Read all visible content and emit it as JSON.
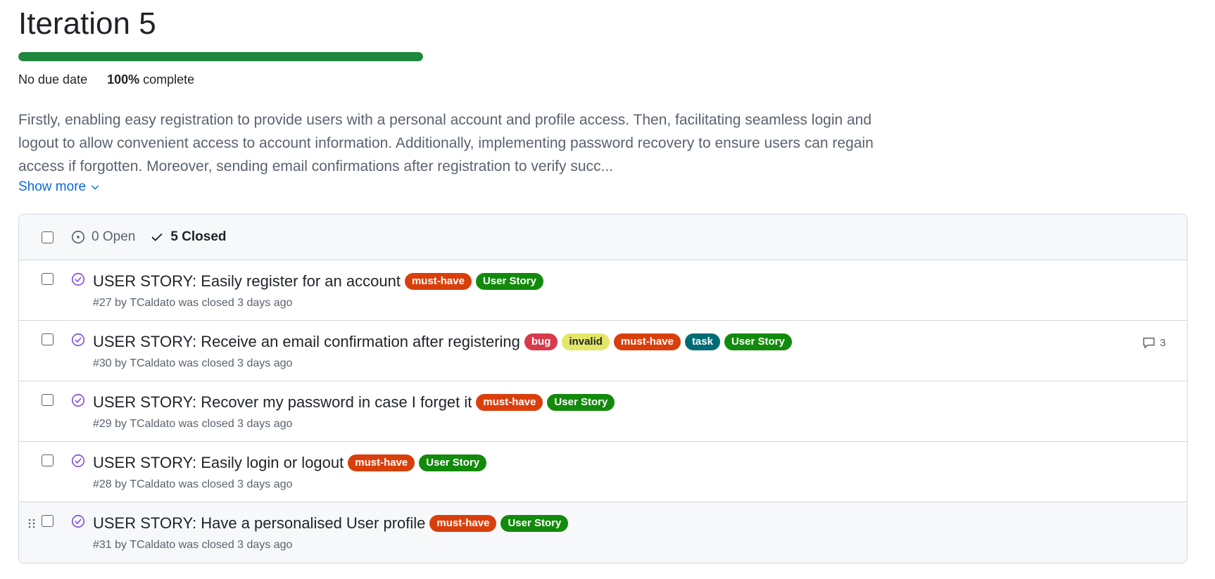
{
  "milestone": {
    "title": "Iteration 5",
    "progress": 1.0,
    "due": "No due date",
    "percent": "100%",
    "complete_label": "complete",
    "description": "Firstly, enabling easy registration to provide users with a personal account and profile access. Then, facilitating seamless login and logout to allow convenient access to account information. Additionally, implementing password recovery to ensure users can regain access if forgotten. Moreover, sending email confirmations after registration to verify succ...",
    "show_more": "Show more"
  },
  "filters": {
    "open_label": "0 Open",
    "closed_label": "5 Closed"
  },
  "colors": {
    "must-have": "#d93f0b",
    "User Story": "#128a0c",
    "bug": "#d73a4a",
    "invalid": "#e4e669",
    "task": "#006b75",
    "progress": "#1f883d",
    "closed_icon": "#8250df"
  },
  "issues": [
    {
      "title": "USER STORY: Easily register for an account",
      "labels": [
        "must-have",
        "User Story"
      ],
      "meta": "#27 by TCaldato was closed 3 days ago",
      "comments": ""
    },
    {
      "title": "USER STORY: Receive an email confirmation after registering",
      "labels": [
        "bug",
        "invalid",
        "must-have",
        "task",
        "User Story"
      ],
      "meta": "#30 by TCaldato was closed 3 days ago",
      "comments": "3"
    },
    {
      "title": "USER STORY: Recover my password in case I forget it",
      "labels": [
        "must-have",
        "User Story"
      ],
      "meta": "#29 by TCaldato was closed 3 days ago",
      "comments": ""
    },
    {
      "title": "USER STORY: Easily login or logout",
      "labels": [
        "must-have",
        "User Story"
      ],
      "meta": "#28 by TCaldato was closed 3 days ago",
      "comments": ""
    },
    {
      "title": "USER STORY: Have a personalised User profile",
      "labels": [
        "must-have",
        "User Story"
      ],
      "meta": "#31 by TCaldato was closed 3 days ago",
      "comments": ""
    }
  ]
}
